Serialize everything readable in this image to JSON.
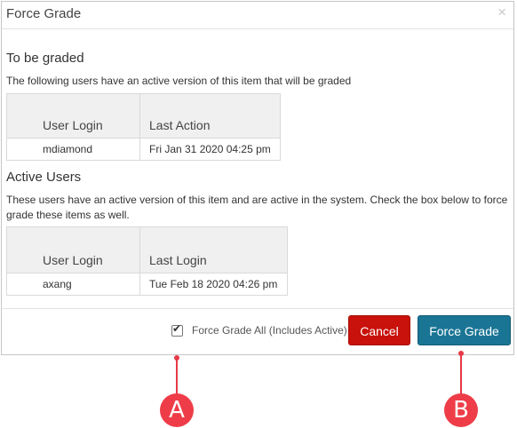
{
  "dialog": {
    "title": "Force Grade",
    "close_glyph": "×"
  },
  "to_be_graded": {
    "title": "To be graded",
    "description": "The following users have an active version of this item that will be graded",
    "columns": [
      "User Login",
      "Last Action"
    ],
    "rows": [
      {
        "user": "mdiamond",
        "last": "Fri Jan 31 2020 04:25 pm"
      }
    ]
  },
  "active_users": {
    "title": "Active Users",
    "description": "These users have an active version of this item and are active in the system. Check the box below to force grade these items as well.",
    "columns": [
      "User Login",
      "Last Login"
    ],
    "rows": [
      {
        "user": "axang",
        "last": "Tue Feb 18 2020 04:26 pm"
      }
    ]
  },
  "footer": {
    "checkbox_label": "Force Grade All (Includes Active)",
    "checkbox_checked": true,
    "cancel_label": "Cancel",
    "force_label": "Force Grade"
  },
  "callouts": {
    "a": "A",
    "b": "B",
    "color": "#ee3d48"
  },
  "colors": {
    "cancel": "#c8120b",
    "primary": "#1a7595"
  }
}
